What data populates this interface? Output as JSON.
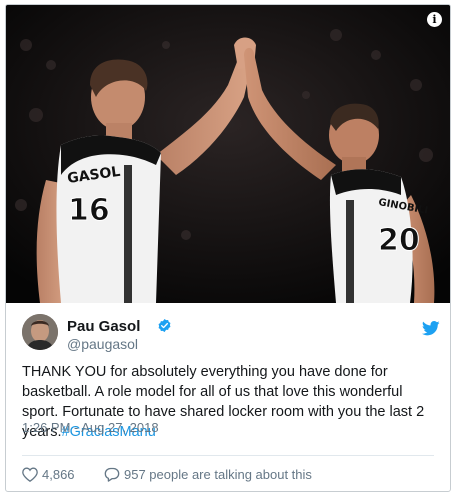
{
  "tweet": {
    "author": {
      "name": "Pau Gasol",
      "handle": "@paugasol",
      "verified": true
    },
    "text": "THANK YOU for absolutely everything you have done for basketball. A role model for all of us that love this wonderful sport. Fortunate to have shared locker room with you the last 2 years.",
    "hashtag": "#GraciasManu",
    "timestamp": "1:26 PM - Aug 27, 2018",
    "likes": "4,866",
    "conversation": "957 people are talking about this"
  },
  "media": {
    "info_label": "i",
    "left_jersey": {
      "name": "GASOL",
      "number": "16"
    },
    "right_jersey": {
      "name": "GINOBILI",
      "number": "20"
    }
  },
  "colors": {
    "link": "#1b95e0",
    "secondary_text": "#657786",
    "verified": "#1da1f2",
    "border": "#c7cdd1"
  },
  "icons": [
    "info-icon",
    "verified-badge-icon",
    "twitter-bird-icon",
    "heart-icon",
    "speech-bubble-icon"
  ]
}
